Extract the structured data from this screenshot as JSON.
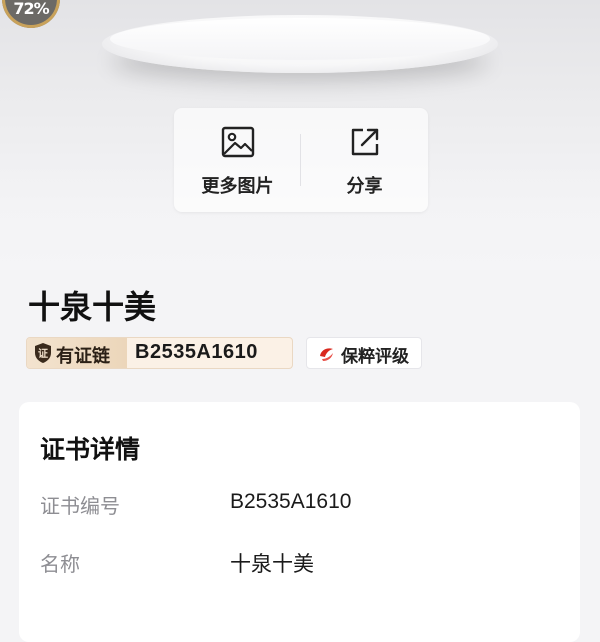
{
  "badge": {
    "text": "72%"
  },
  "actions": [
    {
      "label": "更多图片",
      "icon": "image-icon"
    },
    {
      "label": "分享",
      "icon": "share-icon"
    }
  ],
  "item": {
    "title": "十泉十美",
    "chain_label": "有证链",
    "chain_code": "B2535A1610",
    "grade_label": "保粹评级"
  },
  "details": {
    "heading": "证书详情",
    "rows": [
      {
        "label": "证书编号",
        "value": "B2535A1610"
      },
      {
        "label": "名称",
        "value": "十泉十美"
      }
    ]
  },
  "colors": {
    "accent_gold": "#c9a25a",
    "chain_bg": "#fbf1e6",
    "grade_red": "#d9281e"
  }
}
